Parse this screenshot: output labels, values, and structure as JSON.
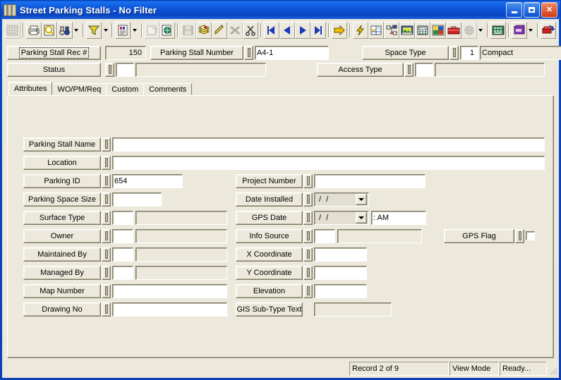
{
  "window": {
    "title": "Street Parking Stalls - No Filter",
    "minimize_label": "Minimize",
    "maximize_label": "Maximize",
    "close_label": "Close"
  },
  "toolbar": {
    "items": [
      {
        "name": "grid-view-icon",
        "title": "Grid View",
        "disabled": true
      },
      {
        "name": "print-icon",
        "title": "Print"
      },
      {
        "name": "print-preview-icon",
        "title": "Print Preview"
      },
      {
        "name": "find-binoculars-icon",
        "title": "Find"
      },
      {
        "name": "filter-funnel-icon",
        "title": "Filter"
      },
      {
        "name": "report-icon",
        "title": "Report"
      },
      {
        "name": "export-icon",
        "title": "Export",
        "disabled": true
      },
      {
        "name": "import-icon",
        "title": "Import"
      },
      {
        "name": "save-icon",
        "title": "Save",
        "disabled": true
      },
      {
        "name": "records-stack-icon",
        "title": "Records"
      },
      {
        "name": "edit-pencil-icon",
        "title": "Edit"
      },
      {
        "name": "delete-x-icon",
        "title": "Delete",
        "disabled": true
      },
      {
        "name": "cut-scissors-icon",
        "title": "Cut"
      },
      {
        "name": "first-record-icon",
        "title": "First Record"
      },
      {
        "name": "previous-record-icon",
        "title": "Previous Record"
      },
      {
        "name": "next-record-icon",
        "title": "Next Record"
      },
      {
        "name": "last-record-icon",
        "title": "Last Record"
      },
      {
        "name": "goto-arrow-icon",
        "title": "Go To"
      },
      {
        "name": "lightning-icon",
        "title": "Quick Action"
      },
      {
        "name": "map-icon",
        "title": "Map"
      },
      {
        "name": "hierarchy-icon",
        "title": "Hierarchy"
      },
      {
        "name": "image-icon",
        "title": "Image"
      },
      {
        "name": "calculator-icon",
        "title": "Calculator"
      },
      {
        "name": "picture-icon",
        "title": "Picture"
      },
      {
        "name": "toolbox-icon",
        "title": "Toolbox"
      },
      {
        "name": "globe-icon",
        "title": "Web",
        "disabled": true
      },
      {
        "name": "keypad-icon",
        "title": "Keypad"
      },
      {
        "name": "book-icon",
        "title": "Help Book"
      },
      {
        "name": "flag-refresh-icon",
        "title": "Refresh"
      }
    ]
  },
  "header": {
    "rec_label": "Parking Stall Rec #",
    "rec_value": "150",
    "stall_number_label": "Parking Stall Number",
    "stall_number_value": "A4-1",
    "space_type_label": "Space Type",
    "space_type_code": "1",
    "space_type_desc": "Compact",
    "status_label": "Status",
    "status_code": "",
    "status_desc": "",
    "access_type_label": "Access Type",
    "access_type_code": "",
    "access_type_desc": ""
  },
  "tabs": [
    {
      "label": "Attributes",
      "active": true
    },
    {
      "label": "WO/PM/Req",
      "active": false
    },
    {
      "label": "Custom",
      "active": false
    },
    {
      "label": "Comments",
      "active": false
    }
  ],
  "attributes": {
    "left_fields": [
      {
        "label": "Parking Stall Name",
        "value": "",
        "type": "wide"
      },
      {
        "label": "Location",
        "value": "",
        "type": "wide"
      },
      {
        "label": "Parking ID",
        "value": "654",
        "type": "medium"
      },
      {
        "label": "Parking Space Size",
        "value": "",
        "type": "small"
      },
      {
        "label": "Surface Type",
        "code": "",
        "desc": "",
        "type": "code-desc"
      },
      {
        "label": "Owner",
        "code": "",
        "desc": "",
        "type": "code-desc"
      },
      {
        "label": "Maintained By",
        "code": "",
        "desc": "",
        "type": "code-desc"
      },
      {
        "label": "Managed By",
        "code": "",
        "desc": "",
        "type": "code-desc"
      },
      {
        "label": "Map Number",
        "value": "",
        "type": "wide-med"
      },
      {
        "label": "Drawing No",
        "value": "",
        "type": "wide-med"
      }
    ],
    "right_fields": [
      {
        "label": "Project Number",
        "value": "",
        "type": "medium"
      },
      {
        "label": "Date Installed",
        "value": "/  /",
        "type": "date"
      },
      {
        "label": "GPS Date",
        "value": "/  /",
        "time_value": ":    AM",
        "type": "datetime"
      },
      {
        "label": "Info Source",
        "code": "",
        "desc": "",
        "type": "code-desc"
      },
      {
        "label": "X Coordinate",
        "value": "",
        "type": "small-med"
      },
      {
        "label": "Y Coordinate",
        "value": "",
        "type": "small-med"
      },
      {
        "label": "Elevation",
        "value": "",
        "type": "small-med"
      },
      {
        "label": "GIS Sub-Type Text",
        "value": "",
        "type": "readonly-nolkp"
      }
    ],
    "gps_flag": {
      "label": "GPS Flag",
      "checked": false
    }
  },
  "statusbar": {
    "record": "Record 2 of 9",
    "mode": "View Mode",
    "state": "Ready..."
  },
  "colors": {
    "title_blue": "#0b52d8",
    "panel": "#ece9dc",
    "field_white": "#ffffff",
    "field_readonly": "#ece9dc",
    "border_dark": "#7d7a68"
  }
}
